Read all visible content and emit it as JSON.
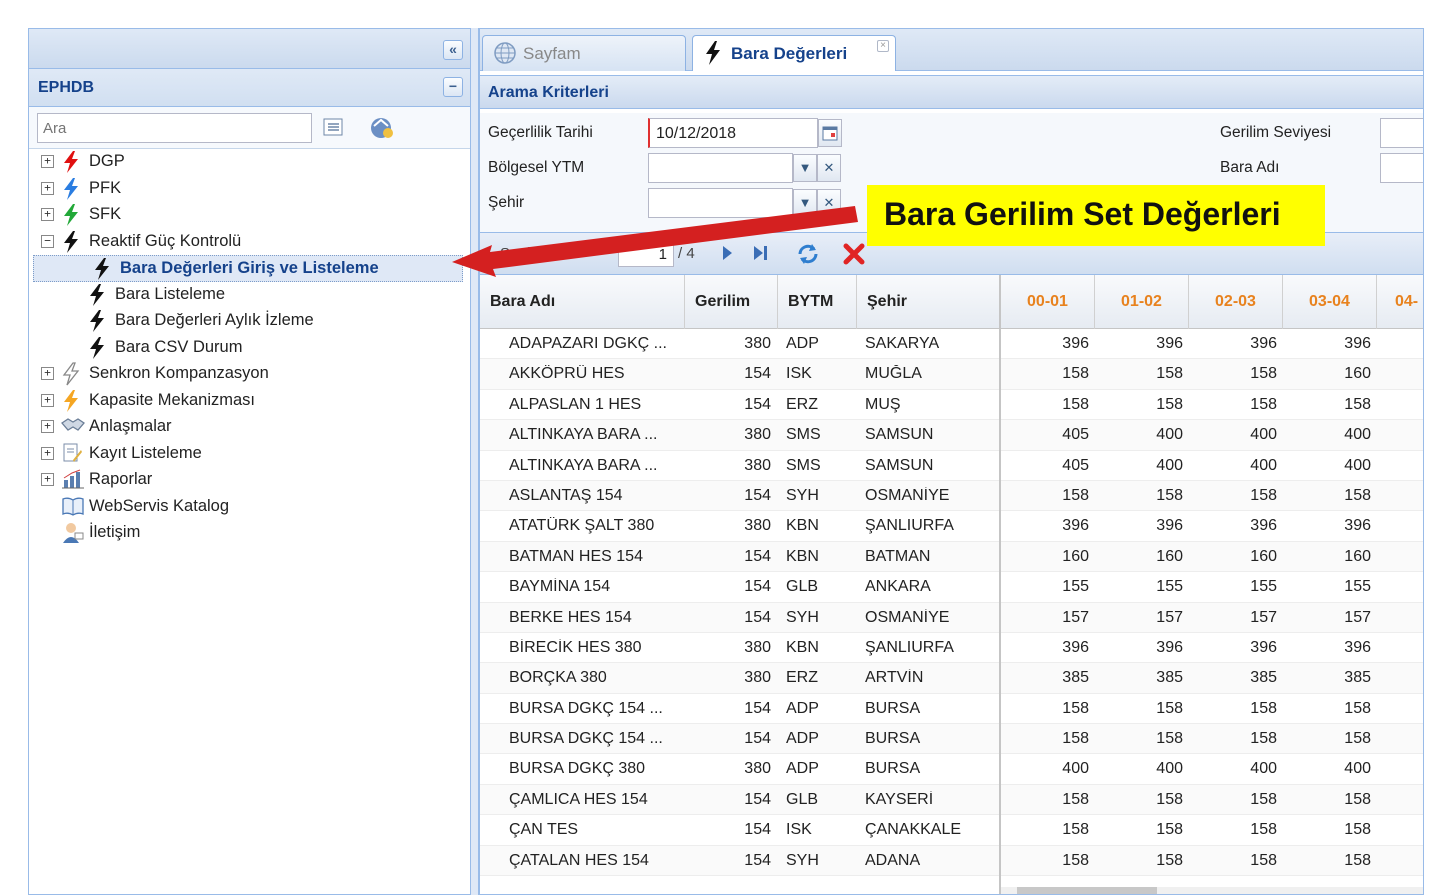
{
  "sidebar": {
    "title": "EPHDB",
    "search_placeholder": "Ara",
    "items": [
      {
        "label": "DGP",
        "expand": "+",
        "icon": "lightning-red-icon",
        "color": "#e01010",
        "indent": 0
      },
      {
        "label": "PFK",
        "expand": "+",
        "icon": "lightning-blue-icon",
        "color": "#2a7de1",
        "indent": 0
      },
      {
        "label": "SFK",
        "expand": "+",
        "icon": "lightning-green-icon",
        "color": "#22a838",
        "indent": 0
      },
      {
        "label": "Reaktif Güç Kontrolü",
        "expand": "−",
        "icon": "lightning-black-icon",
        "color": "#111111",
        "indent": 0
      },
      {
        "label": "Bara Değerleri Giriş ve Listeleme",
        "expand": "",
        "icon": "lightning-black-icon",
        "color": "#111111",
        "indent": 1,
        "selected": true
      },
      {
        "label": "Bara Listeleme",
        "expand": "",
        "icon": "lightning-black-icon",
        "color": "#111111",
        "indent": 1
      },
      {
        "label": "Bara Değerleri Aylık İzleme",
        "expand": "",
        "icon": "lightning-black-icon",
        "color": "#111111",
        "indent": 1
      },
      {
        "label": "Bara CSV Durum",
        "expand": "",
        "icon": "lightning-black-icon",
        "color": "#111111",
        "indent": 1
      },
      {
        "label": "Senkron Kompanzasyon",
        "expand": "+",
        "icon": "lightning-outline-icon",
        "color": "#888888",
        "indent": 0
      },
      {
        "label": "Kapasite Mekanizması",
        "expand": "+",
        "icon": "lightning-orange-icon",
        "color": "#f5a623",
        "indent": 0
      },
      {
        "label": "Anlaşmalar",
        "expand": "+",
        "icon": "handshake-icon",
        "color": "#6a7d96",
        "indent": 0
      },
      {
        "label": "Kayıt Listeleme",
        "expand": "+",
        "icon": "document-edit-icon",
        "color": "#7b8ea8",
        "indent": 0
      },
      {
        "label": "Raporlar",
        "expand": "+",
        "icon": "bar-chart-icon",
        "color": "#5b7fb0",
        "indent": 0
      },
      {
        "label": "WebServis Katalog",
        "expand": "",
        "icon": "book-icon",
        "color": "#4a78b5",
        "indent": 0
      },
      {
        "label": "İletişim",
        "expand": "",
        "icon": "contact-person-icon",
        "color": "#4a78b5",
        "indent": 0
      }
    ]
  },
  "tabs": [
    {
      "label": "Sayfam",
      "icon": "globe-icon",
      "active": false
    },
    {
      "label": "Bara Değerleri",
      "icon": "lightning-black-icon",
      "active": true,
      "closable": true
    }
  ],
  "criteria": {
    "section_title": "Arama Kriterleri",
    "date_label": "Geçerlilik Tarihi",
    "date_value": "10/12/2018",
    "region_label": "Bölgesel YTM",
    "region_value": "",
    "city_label": "Şehir",
    "city_value": "",
    "voltage_label": "Gerilim Seviyesi",
    "bara_label": "Bara Adı"
  },
  "pager": {
    "page_label": "Sayfa",
    "page_value": "1",
    "page_total": "/ 4"
  },
  "grid": {
    "columns": [
      "Bara Adı",
      "Gerilim",
      "BYTM",
      "Şehir",
      "00-01",
      "01-02",
      "02-03",
      "03-04",
      "04-"
    ],
    "rows": [
      [
        "ADAPAZARI DGKÇ ...",
        "380",
        "ADP",
        "SAKARYA",
        "396",
        "396",
        "396",
        "396"
      ],
      [
        "AKKÖPRÜ HES",
        "154",
        "ISK",
        "MUĞLA",
        "158",
        "158",
        "158",
        "160"
      ],
      [
        "ALPASLAN 1 HES",
        "154",
        "ERZ",
        "MUŞ",
        "158",
        "158",
        "158",
        "158"
      ],
      [
        "ALTINKAYA BARA ...",
        "380",
        "SMS",
        "SAMSUN",
        "405",
        "400",
        "400",
        "400"
      ],
      [
        "ALTINKAYA BARA ...",
        "380",
        "SMS",
        "SAMSUN",
        "405",
        "400",
        "400",
        "400"
      ],
      [
        "ASLANTAŞ 154",
        "154",
        "SYH",
        "OSMANİYE",
        "158",
        "158",
        "158",
        "158"
      ],
      [
        "ATATÜRK ŞALT 380",
        "380",
        "KBN",
        "ŞANLIURFA",
        "396",
        "396",
        "396",
        "396"
      ],
      [
        "BATMAN HES 154",
        "154",
        "KBN",
        "BATMAN",
        "160",
        "160",
        "160",
        "160"
      ],
      [
        "BAYMİNA 154",
        "154",
        "GLB",
        "ANKARA",
        "155",
        "155",
        "155",
        "155"
      ],
      [
        "BERKE HES 154",
        "154",
        "SYH",
        "OSMANİYE",
        "157",
        "157",
        "157",
        "157"
      ],
      [
        "BİRECİK HES 380",
        "380",
        "KBN",
        "ŞANLIURFA",
        "396",
        "396",
        "396",
        "396"
      ],
      [
        "BORÇKA 380",
        "380",
        "ERZ",
        "ARTVİN",
        "385",
        "385",
        "385",
        "385"
      ],
      [
        "BURSA DGKÇ 154 ...",
        "154",
        "ADP",
        "BURSA",
        "158",
        "158",
        "158",
        "158"
      ],
      [
        "BURSA DGKÇ 154 ...",
        "154",
        "ADP",
        "BURSA",
        "158",
        "158",
        "158",
        "158"
      ],
      [
        "BURSA DGKÇ 380",
        "380",
        "ADP",
        "BURSA",
        "400",
        "400",
        "400",
        "400"
      ],
      [
        "ÇAMLICA HES 154",
        "154",
        "GLB",
        "KAYSERİ",
        "158",
        "158",
        "158",
        "158"
      ],
      [
        "ÇAN TES",
        "154",
        "ISK",
        "ÇANAKKALE",
        "158",
        "158",
        "158",
        "158"
      ],
      [
        "ÇATALAN HES 154",
        "154",
        "SYH",
        "ADANA",
        "158",
        "158",
        "158",
        "158"
      ]
    ]
  },
  "callout": {
    "text": "Bara Gerilim Set Değerleri",
    "bg_color": "#ffff00",
    "arrow_color": "#d42020"
  }
}
